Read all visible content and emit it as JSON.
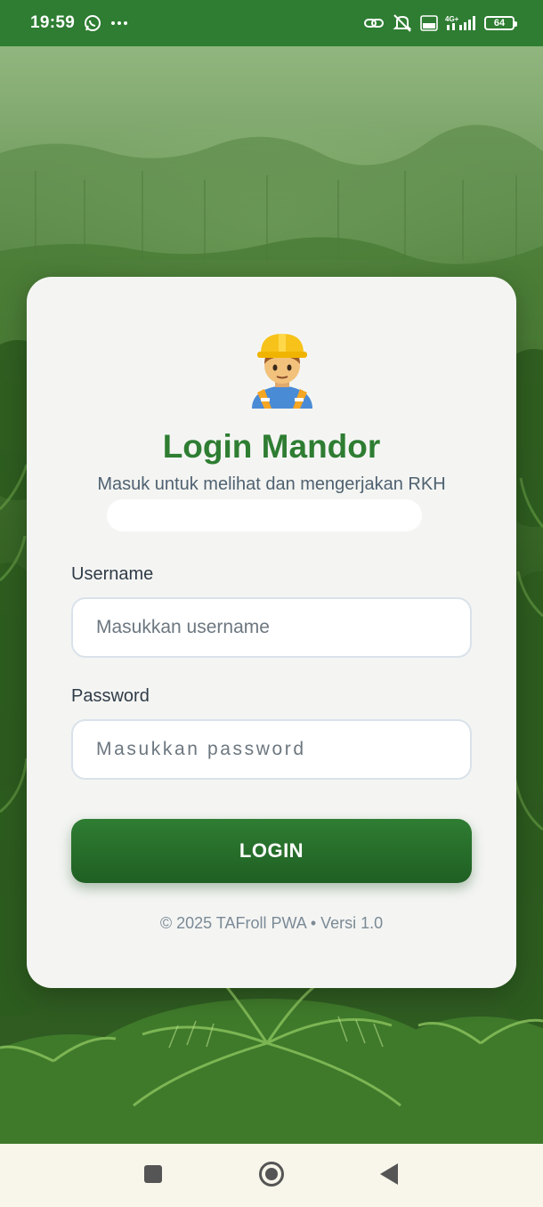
{
  "status_bar": {
    "time": "19:59",
    "battery": "64",
    "network_label": "4G+"
  },
  "login": {
    "icon": "construction-worker-icon",
    "title": "Login Mandor",
    "subtitle": "Masuk untuk melihat dan mengerjakan RKH",
    "username_label": "Username",
    "username_placeholder": "Masukkan username",
    "username_value": "",
    "password_label": "Password",
    "password_placeholder": "Masukkan password",
    "password_value": "",
    "button_label": "LOGIN",
    "footer": "© 2025 TAFroll PWA • Versi 1.0"
  },
  "colors": {
    "brand_green": "#2e7d32",
    "status_bar": "#2e7d32",
    "card_bg": "#f4f5f3"
  },
  "nav_bar": {
    "recents": "square-icon",
    "home": "circle-icon",
    "back": "triangle-back-icon"
  }
}
